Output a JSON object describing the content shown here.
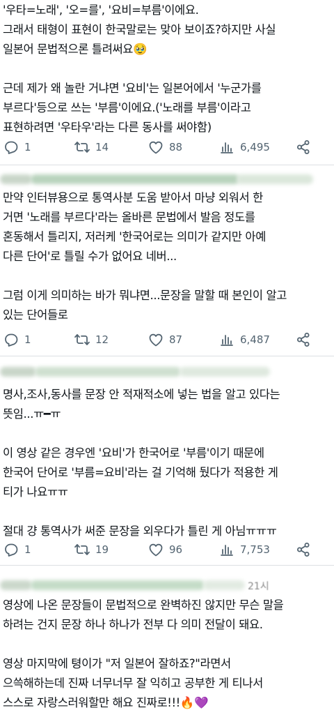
{
  "posts": [
    {
      "lines": [
        "'우타=노래', '오=를', '요비=부름'이에요.",
        "그래서 태형이 표현이 한국말로는 맞아 보이죠?하지만 사실",
        "일본어 문법적으론 틀려써요🥹",
        "",
        "근데 제가 왜 놀란 거냐면 '요비'는 일본어에서 '누군가를",
        "부르다'등으로 쓰는 '부름'이에요.('노래를 부름'이라고",
        "표현하려면 '우타우'라는 다른 동사를 써야함)"
      ],
      "stats": {
        "replies": "1",
        "reposts": "14",
        "likes": "88",
        "views": "6,495"
      }
    },
    {
      "lines": [
        "만약 인터뷰용으로 통역사분 도움 받아서 마냥 외워서 한",
        "거면 '노래를 부르다'라는 올바른 문법에서 발음 정도를",
        "혼동해서 틀리지, 저러케 '한국어로는 의미가 같지만 아예",
        "다른 단어'로 틀릴 수가 없어요 네버...",
        "",
        "그럼 이게 의미하는 바가 뭐냐면...문장을 말할 때 본인이 알고",
        "있는 단어들로"
      ],
      "stats": {
        "replies": "1",
        "reposts": "12",
        "likes": "87",
        "views": "6,487"
      }
    },
    {
      "lines": [
        "명사,조사,동사를 문장 안 적재적소에 넣는 법을 알고 있다는",
        "뜻임...ㅠ━ㅠ",
        "",
        "이 영상 같은 경우엔 '요비'가 한국어로 '부름'이기 때문에",
        "한국어 단어로 '부름=요비'라는 걸 기억해 뒀다가 적용한 게",
        "티가 나요ㅠㅠ",
        "",
        "절대 걍 통역사가 써준 문장을 외우다가 틀린 게 아님ㅠㅠㅠ"
      ],
      "stats": {
        "replies": "1",
        "reposts": "19",
        "likes": "96",
        "views": "7,753"
      }
    },
    {
      "lines": [
        "영상에 나온 문장들이 문법적으로 완벽하진 않지만 무슨 말을",
        "하려는 건지 문장 하나 하나가 전부 다 의미 전달이 돼요.",
        "",
        "영상 마지막에 텽이가 \"저 일본어 잘하죠?\"라면서",
        "으쓱해하는데 진짜 너무너무 잘 익히고 공부한 게 티나서",
        "스스로 자랑스러워할만 해요 진짜로!!!🔥💜"
      ]
    }
  ],
  "header4_time": "21시",
  "icons": {
    "reply": "reply-icon",
    "repost": "repost-icon",
    "like": "heart-icon",
    "views": "views-icon",
    "share": "share-icon"
  },
  "colors": {
    "text": "#0f1419",
    "muted": "#536471",
    "divider": "#dcdfe3"
  }
}
